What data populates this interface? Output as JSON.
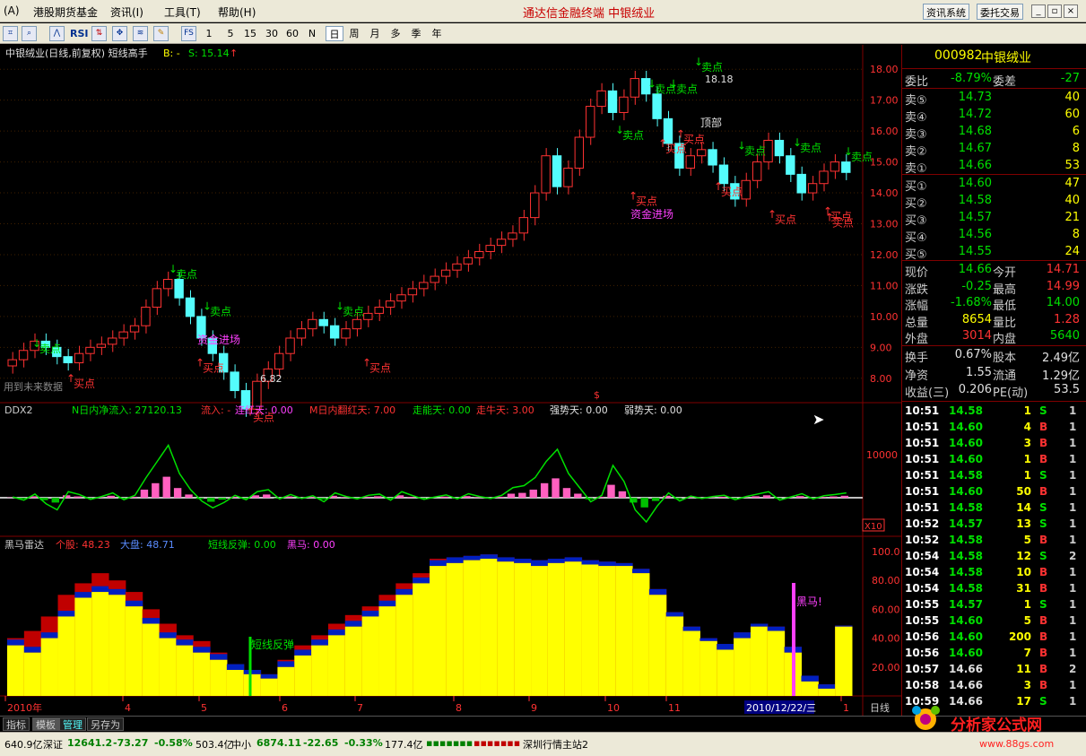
{
  "menu": {
    "items": [
      "(A)",
      "港股期货基金",
      "资讯(I)",
      "工具(T)",
      "帮助(H)"
    ],
    "title": "通达信金融终端 中银绒业",
    "news_btn": "资讯系统",
    "trade_btn": "委托交易"
  },
  "toolbar": {
    "periods": [
      "1",
      "5",
      "15",
      "30",
      "60",
      "N",
      "日",
      "周",
      "月",
      "多",
      "季",
      "年"
    ],
    "rsi": "RSI",
    "fs": "FS"
  },
  "main": {
    "title": "中银绒业(日线,前复权) 短线高手",
    "b": "B: -",
    "s": "S: 15.14",
    "future": "用到未来数据",
    "prices": [
      "18.00",
      "17.00",
      "16.00",
      "15.00",
      "14.00",
      "13.00",
      "12.00",
      "11.00",
      "10.00",
      "9.00",
      "8.00"
    ],
    "hi": "18.18",
    "lo": "6.82",
    "top_lbl": "顶部",
    "fund_lbl": "资金进场",
    "sell": "卖点",
    "buy": "买点",
    "dollar": "$"
  },
  "ddx": {
    "name": "DDX2",
    "f1": "N日内净流入: 27120.13",
    "f2": "流入: -",
    "f3": "连红天: 0.00",
    "f4": "M日内翻红天: 7.00",
    "f5": "走能天: 0.00",
    "f6": "走牛天: 3.00",
    "f7": "强势天: 0.00",
    "f8": "弱势天: 0.00",
    "axis": "10000",
    "x10": "X10"
  },
  "radar": {
    "name": "黑马雷达",
    "f1": "个股: 48.23",
    "f2": "大盘: 48.71",
    "f3": "短线反弹: 0.00",
    "f4": "黑马: 0.00",
    "ticks": [
      "100.0",
      "80.00",
      "60.00",
      "40.00",
      "20.00"
    ],
    "rebound": "短线反弹",
    "horse": "黑马!"
  },
  "xaxis": {
    "labels": [
      "2010年",
      "4",
      "5",
      "6",
      "7",
      "8",
      "9",
      "10",
      "11",
      "1"
    ],
    "date": "2010/12/22/三",
    "period": "日线"
  },
  "quote": {
    "code": "000982",
    "name": "中银绒业",
    "ratio": {
      "l1": "委比",
      "v1": "-8.79%",
      "l2": "委差",
      "v2": "-27"
    },
    "asks": [
      {
        "l": "卖⑤",
        "p": "14.73",
        "v": "40"
      },
      {
        "l": "卖④",
        "p": "14.72",
        "v": "60"
      },
      {
        "l": "卖③",
        "p": "14.68",
        "v": "6"
      },
      {
        "l": "卖②",
        "p": "14.67",
        "v": "8"
      },
      {
        "l": "卖①",
        "p": "14.66",
        "v": "53"
      }
    ],
    "bids": [
      {
        "l": "买①",
        "p": "14.60",
        "v": "47"
      },
      {
        "l": "买②",
        "p": "14.58",
        "v": "40"
      },
      {
        "l": "买③",
        "p": "14.57",
        "v": "21"
      },
      {
        "l": "买④",
        "p": "14.56",
        "v": "8"
      },
      {
        "l": "买⑤",
        "p": "14.55",
        "v": "24"
      }
    ],
    "stats": [
      {
        "l1": "现价",
        "v1": "14.66",
        "l2": "今开",
        "v2": "14.71"
      },
      {
        "l1": "涨跌",
        "v1": "-0.25",
        "l2": "最高",
        "v2": "14.99"
      },
      {
        "l1": "涨幅",
        "v1": "-1.68%",
        "l2": "最低",
        "v2": "14.00"
      },
      {
        "l1": "总量",
        "v1": "8654",
        "l2": "量比",
        "v2": "1.28"
      },
      {
        "l1": "外盘",
        "v1": "3014",
        "l2": "内盘",
        "v2": "5640"
      }
    ],
    "fin": [
      {
        "l1": "换手",
        "v1": "0.67%",
        "l2": "股本",
        "v2": "2.49亿"
      },
      {
        "l1": "净资",
        "v1": "1.55",
        "l2": "流通",
        "v2": "1.29亿"
      },
      {
        "l1": "收益(三)",
        "v1": "0.206",
        "l2": "PE(动)",
        "v2": "53.5"
      }
    ],
    "ticks": [
      [
        "10:51",
        "14.58",
        "1",
        "S",
        "1"
      ],
      [
        "10:51",
        "14.60",
        "4",
        "B",
        "1"
      ],
      [
        "10:51",
        "14.60",
        "3",
        "B",
        "1"
      ],
      [
        "10:51",
        "14.60",
        "1",
        "B",
        "1"
      ],
      [
        "10:51",
        "14.58",
        "1",
        "S",
        "1"
      ],
      [
        "10:51",
        "14.60",
        "50",
        "B",
        "1"
      ],
      [
        "10:51",
        "14.58",
        "14",
        "S",
        "1"
      ],
      [
        "10:52",
        "14.57",
        "13",
        "S",
        "1"
      ],
      [
        "10:52",
        "14.58",
        "5",
        "B",
        "1"
      ],
      [
        "10:54",
        "14.58",
        "12",
        "S",
        "2"
      ],
      [
        "10:54",
        "14.58",
        "10",
        "B",
        "1"
      ],
      [
        "10:54",
        "14.58",
        "31",
        "B",
        "1"
      ],
      [
        "10:55",
        "14.57",
        "1",
        "S",
        "1"
      ],
      [
        "10:55",
        "14.60",
        "5",
        "B",
        "1"
      ],
      [
        "10:56",
        "14.60",
        "200",
        "B",
        "1"
      ],
      [
        "10:56",
        "14.60",
        "7",
        "B",
        "1"
      ],
      [
        "10:57",
        "14.66",
        "11",
        "B",
        "2"
      ],
      [
        "10:58",
        "14.66",
        "3",
        "B",
        "1"
      ],
      [
        "10:59",
        "14.66",
        "17",
        "S",
        "1"
      ]
    ]
  },
  "tabs": [
    "指标",
    "模板",
    "管理",
    "另存为"
  ],
  "status": {
    "s1": "640.9亿",
    "s2": "深证",
    "s3": "12641.2",
    "s4": "-73.27",
    "s5": "-0.58%",
    "s6": "503.4亿",
    "s7": "中小",
    "s8": "6874.11",
    "s9": "-22.65",
    "s10": "-0.33%",
    "s11": "177.4亿",
    "s12": "深圳行情主站2"
  },
  "logo": {
    "name": "分析家公式网",
    "url": "www.88gs.com"
  },
  "colors": {
    "up": "#ff3232",
    "down": "#54fcfc",
    "accent": "#ffff00",
    "green": "#00e000",
    "panel_border": "#800000"
  },
  "chart_data": [
    {
      "type": "candlestick",
      "title": "中银绒业(日线,前复权) 短线高手",
      "ylim": [
        7.5,
        18.5
      ],
      "x": [
        "2010年",
        "4",
        "5",
        "6",
        "7",
        "8",
        "9",
        "10",
        "11",
        "1"
      ],
      "close": [
        8.6,
        8.9,
        9.2,
        9.0,
        8.7,
        8.5,
        8.8,
        9.0,
        9.1,
        9.3,
        9.5,
        9.7,
        10.3,
        10.9,
        11.2,
        10.6,
        10.0,
        9.3,
        8.8,
        8.2,
        7.6,
        7.0,
        7.9,
        8.3,
        8.8,
        9.3,
        9.6,
        9.9,
        9.7,
        9.3,
        9.6,
        9.9,
        10.1,
        10.3,
        10.5,
        10.7,
        10.9,
        11.1,
        11.3,
        11.5,
        11.7,
        11.9,
        12.1,
        12.3,
        12.5,
        12.7,
        13.2,
        14.0,
        15.2,
        14.2,
        14.8,
        15.8,
        16.8,
        17.3,
        16.6,
        17.1,
        17.7,
        17.2,
        16.4,
        15.6,
        14.8,
        15.2,
        15.4,
        14.9,
        14.3,
        13.8,
        14.4,
        15.0,
        15.7,
        15.2,
        14.6,
        14.0,
        14.3,
        14.7,
        15.0,
        14.66
      ]
    },
    {
      "type": "bar",
      "title": "DDX2",
      "ylim": [
        -10000,
        15000
      ],
      "values": [
        200,
        -600,
        900,
        -1500,
        -3000,
        1500,
        800,
        -400,
        300,
        1200,
        -500,
        600,
        5000,
        9000,
        13000,
        6000,
        2000,
        -800,
        -2500,
        -1200,
        600,
        -500,
        1500,
        2000,
        -300,
        800,
        -200,
        500,
        -1000,
        1200,
        300,
        -300,
        600,
        900,
        -600,
        1500,
        500,
        -400,
        200,
        700,
        -300,
        1000,
        300,
        -200,
        600,
        2500,
        3000,
        5000,
        9000,
        12000,
        6000,
        2500,
        -1000,
        600,
        8000,
        4000,
        -3000,
        -6000,
        -2000,
        1200,
        -800,
        400,
        -200,
        300,
        600,
        -500,
        300,
        900,
        1500,
        -600,
        200,
        1000,
        -300,
        500,
        800,
        1200
      ]
    },
    {
      "type": "area",
      "title": "黑马雷达",
      "ylim": [
        0,
        100
      ],
      "series": [
        {
          "name": "个股",
          "values": [
            35,
            30,
            40,
            55,
            68,
            72,
            70,
            62,
            50,
            40,
            35,
            30,
            25,
            18,
            15,
            12,
            20,
            28,
            35,
            42,
            48,
            55,
            62,
            70,
            78,
            90,
            92,
            94,
            95,
            93,
            92,
            90,
            92,
            93,
            91,
            90,
            90,
            85,
            70,
            55,
            45,
            38,
            32,
            40,
            48,
            45,
            30,
            10,
            5,
            48
          ]
        },
        {
          "name": "大盘",
          "values": [
            40,
            45,
            55,
            70,
            78,
            85,
            80,
            72,
            60,
            50,
            42,
            38,
            30,
            22,
            18,
            15,
            25,
            35,
            42,
            50,
            56,
            62,
            70,
            78,
            85,
            95,
            96,
            97,
            98,
            96,
            95,
            94,
            95,
            96,
            94,
            93,
            92,
            88,
            74,
            58,
            48,
            40,
            36,
            44,
            50,
            48,
            34,
            14,
            8,
            48.71
          ]
        }
      ]
    }
  ]
}
